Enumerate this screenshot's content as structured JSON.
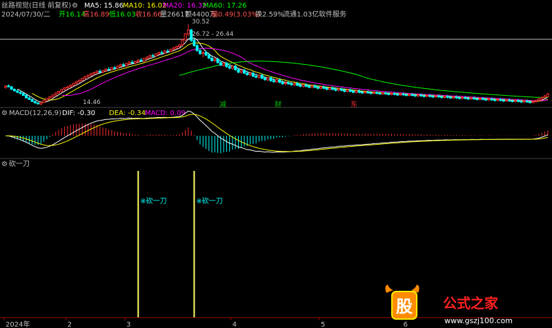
{
  "header": {
    "app_title": "丝路视觉(日线 前复权)",
    "ma_items": [
      {
        "label": "MA5: 15.86",
        "color": "#ffffff"
      },
      {
        "label": "MA10: 16.02",
        "color": "#ffff00"
      },
      {
        "label": "MA20: 16.32",
        "color": "#ff00ff"
      },
      {
        "label": "MA60: 17.26",
        "color": "#00ff00"
      }
    ],
    "ohlc_items": [
      {
        "label": "2024/07/30/二",
        "color": "#c0c0c0"
      },
      {
        "label": "开16.14",
        "color": "#00ff00"
      },
      {
        "label": "高16.89",
        "color": "#ff5050"
      },
      {
        "label": "低16.03",
        "color": "#00ff00"
      },
      {
        "label": "收16.66",
        "color": "#ff5050"
      },
      {
        "label": "量26617",
        "color": "#c0c0c0"
      },
      {
        "label": "额4400万",
        "color": "#c0c0c0"
      },
      {
        "label": "幅0.49(3.03%)",
        "color": "#ff5050"
      },
      {
        "label": "换2.59%",
        "color": "#c0c0c0"
      },
      {
        "label": "流通1.03亿",
        "color": "#c0c0c0"
      },
      {
        "label": "软件服务",
        "color": "#c0c0c0"
      }
    ]
  },
  "price_annotations": {
    "high": "30.52",
    "range": "26.72 - 26.44",
    "low": "14.46"
  },
  "event_markers": [
    {
      "label": "减",
      "color": "#00c000"
    },
    {
      "label": "财",
      "color": "#00c000"
    },
    {
      "label": "东",
      "color": "#ff3030"
    }
  ],
  "macd": {
    "title": "MACD(12,26,9)",
    "dif_label": "DIF: -0.30",
    "dea_label": "DEA: -0.34",
    "macd_label": "MACD: 0.09",
    "colors": {
      "dif": "#ffffff",
      "dea": "#ffff00",
      "macd": "#ff00ff",
      "pos_bar": "#ff3030",
      "neg_bar": "#00ffff"
    }
  },
  "indicator": {
    "title": "砍一刀",
    "signal_label": "※砍一刀",
    "signals": [
      {
        "index": 45
      },
      {
        "index": 64
      }
    ],
    "line_color": "#ffff66"
  },
  "xaxis": {
    "ticks": [
      {
        "label": "2024年",
        "index": 0
      },
      {
        "label": "2",
        "index": 21
      },
      {
        "label": "3",
        "index": 41
      },
      {
        "label": "4",
        "index": 77
      },
      {
        "label": "5",
        "index": 107
      },
      {
        "label": "6",
        "index": 135
      }
    ]
  },
  "watermark": {
    "glyph": "股",
    "text": "公式之家",
    "url": "www.gszj100.com"
  },
  "chart_data": {
    "type": "candlestick",
    "index_range": [
      0,
      200
    ],
    "candles": [
      [
        18.0,
        18.4,
        17.7,
        18.3
      ],
      [
        18.3,
        18.6,
        18.0,
        18.1
      ],
      [
        18.1,
        18.3,
        17.5,
        17.6
      ],
      [
        17.6,
        17.8,
        17.2,
        17.3
      ],
      [
        17.3,
        17.6,
        16.9,
        17.0
      ],
      [
        17.0,
        17.4,
        16.6,
        16.8
      ],
      [
        16.8,
        17.0,
        16.3,
        16.4
      ],
      [
        16.4,
        16.6,
        15.8,
        15.9
      ],
      [
        15.9,
        16.2,
        15.5,
        15.6
      ],
      [
        15.6,
        15.8,
        15.1,
        15.2
      ],
      [
        15.2,
        15.4,
        14.8,
        14.9
      ],
      [
        14.9,
        15.1,
        14.6,
        14.7
      ],
      [
        14.7,
        15.2,
        14.46,
        15.0
      ],
      [
        15.0,
        15.5,
        14.9,
        15.4
      ],
      [
        15.4,
        15.9,
        15.3,
        15.8
      ],
      [
        15.8,
        16.3,
        15.7,
        16.1
      ],
      [
        16.1,
        16.6,
        16.0,
        16.5
      ],
      [
        16.5,
        17.0,
        16.3,
        16.9
      ],
      [
        16.9,
        17.3,
        16.7,
        17.2
      ],
      [
        17.2,
        17.7,
        17.0,
        17.6
      ],
      [
        17.6,
        18.0,
        17.3,
        17.9
      ],
      [
        17.9,
        18.3,
        17.6,
        18.1
      ],
      [
        18.1,
        18.6,
        17.9,
        18.4
      ],
      [
        18.4,
        18.9,
        18.2,
        18.8
      ],
      [
        18.8,
        19.3,
        18.6,
        19.1
      ],
      [
        19.1,
        19.6,
        18.9,
        19.4
      ],
      [
        19.4,
        19.9,
        19.2,
        19.8
      ],
      [
        19.8,
        20.3,
        19.5,
        20.1
      ],
      [
        20.1,
        20.6,
        19.9,
        20.4
      ],
      [
        20.4,
        20.9,
        20.2,
        20.7
      ],
      [
        20.7,
        21.1,
        20.4,
        20.9
      ],
      [
        20.9,
        21.4,
        20.7,
        21.2
      ],
      [
        21.2,
        21.6,
        20.9,
        21.0
      ],
      [
        21.0,
        21.5,
        20.8,
        21.3
      ],
      [
        21.3,
        21.8,
        21.1,
        21.6
      ],
      [
        21.6,
        22.0,
        21.3,
        21.5
      ],
      [
        21.5,
        22.1,
        21.4,
        21.9
      ],
      [
        21.9,
        22.3,
        21.6,
        21.8
      ],
      [
        21.8,
        22.4,
        21.7,
        22.2
      ],
      [
        22.2,
        22.7,
        22.0,
        22.5
      ],
      [
        22.5,
        22.9,
        22.2,
        22.3
      ],
      [
        22.3,
        22.9,
        22.1,
        22.7
      ],
      [
        22.7,
        23.2,
        22.5,
        23.0
      ],
      [
        23.0,
        23.4,
        22.7,
        22.8
      ],
      [
        22.8,
        23.3,
        22.6,
        23.1
      ],
      [
        23.1,
        23.6,
        22.9,
        23.4
      ],
      [
        23.4,
        23.8,
        23.1,
        23.2
      ],
      [
        23.2,
        23.9,
        23.0,
        23.7
      ],
      [
        23.7,
        24.2,
        23.5,
        24.0
      ],
      [
        24.0,
        24.5,
        23.8,
        24.3
      ],
      [
        24.3,
        24.7,
        24.0,
        24.2
      ],
      [
        24.2,
        24.8,
        24.1,
        24.6
      ],
      [
        24.6,
        25.1,
        24.4,
        24.9
      ],
      [
        24.9,
        25.3,
        24.6,
        24.8
      ],
      [
        24.8,
        25.4,
        24.7,
        25.2
      ],
      [
        25.2,
        25.6,
        24.9,
        25.1
      ],
      [
        25.1,
        25.7,
        25.0,
        25.5
      ],
      [
        25.5,
        26.0,
        25.3,
        25.8
      ],
      [
        25.8,
        26.3,
        25.6,
        26.1
      ],
      [
        26.1,
        26.6,
        25.9,
        26.4
      ],
      [
        26.4,
        27.6,
        26.2,
        27.4
      ],
      [
        27.4,
        28.8,
        27.2,
        28.6
      ],
      [
        28.6,
        30.52,
        28.2,
        29.4
      ],
      [
        29.4,
        29.6,
        27.0,
        27.3
      ],
      [
        27.3,
        27.8,
        26.0,
        26.3
      ],
      [
        26.3,
        26.6,
        25.0,
        25.3
      ],
      [
        25.3,
        25.7,
        24.4,
        24.7
      ],
      [
        24.7,
        25.2,
        24.0,
        24.9
      ],
      [
        24.9,
        25.3,
        24.2,
        24.4
      ],
      [
        24.4,
        24.9,
        23.6,
        23.8
      ],
      [
        23.8,
        24.2,
        23.1,
        23.3
      ],
      [
        23.3,
        23.9,
        23.0,
        23.6
      ],
      [
        23.6,
        23.9,
        22.7,
        22.9
      ],
      [
        22.9,
        23.3,
        22.2,
        22.4
      ],
      [
        22.4,
        23.0,
        22.1,
        22.8
      ],
      [
        22.8,
        23.1,
        21.9,
        22.1
      ],
      [
        22.1,
        22.6,
        21.6,
        21.8
      ],
      [
        21.8,
        22.4,
        21.5,
        22.2
      ],
      [
        22.2,
        22.5,
        21.3,
        21.5
      ],
      [
        21.5,
        21.9,
        20.8,
        21.0
      ],
      [
        21.0,
        21.6,
        20.7,
        21.4
      ],
      [
        21.4,
        21.7,
        20.6,
        20.8
      ],
      [
        20.8,
        21.3,
        20.3,
        20.5
      ],
      [
        20.5,
        21.0,
        20.2,
        20.8
      ],
      [
        20.8,
        21.1,
        20.0,
        20.2
      ],
      [
        20.2,
        20.7,
        19.8,
        20.0
      ],
      [
        20.0,
        20.6,
        19.7,
        20.4
      ],
      [
        20.4,
        20.7,
        19.6,
        19.8
      ],
      [
        19.8,
        20.2,
        19.3,
        19.5
      ],
      [
        19.5,
        20.1,
        19.2,
        19.9
      ],
      [
        19.9,
        20.2,
        19.1,
        19.3
      ],
      [
        19.3,
        19.8,
        18.9,
        19.1
      ],
      [
        19.1,
        19.7,
        18.9,
        19.5
      ],
      [
        19.5,
        19.8,
        18.8,
        19.0
      ],
      [
        19.0,
        19.4,
        18.5,
        18.7
      ],
      [
        18.7,
        19.2,
        18.4,
        18.9
      ],
      [
        18.9,
        19.3,
        18.5,
        18.7
      ],
      [
        18.7,
        19.1,
        18.3,
        18.5
      ],
      [
        18.5,
        19.0,
        18.3,
        18.8
      ],
      [
        18.8,
        19.1,
        18.2,
        18.4
      ],
      [
        18.4,
        18.8,
        18.0,
        18.2
      ],
      [
        18.2,
        18.7,
        18.0,
        18.5
      ],
      [
        18.5,
        18.8,
        18.0,
        18.2
      ],
      [
        18.2,
        18.6,
        17.8,
        18.0
      ],
      [
        18.0,
        18.5,
        17.8,
        18.3
      ],
      [
        18.3,
        18.6,
        17.8,
        18.0
      ],
      [
        18.0,
        18.4,
        17.6,
        17.8
      ],
      [
        17.8,
        18.3,
        17.6,
        18.1
      ],
      [
        18.1,
        18.4,
        17.6,
        17.8
      ],
      [
        17.8,
        18.2,
        17.4,
        17.6
      ],
      [
        17.6,
        18.1,
        17.4,
        17.9
      ],
      [
        17.9,
        18.2,
        17.4,
        17.6
      ],
      [
        17.6,
        18.0,
        17.2,
        17.4
      ],
      [
        17.4,
        17.9,
        17.2,
        17.7
      ],
      [
        17.7,
        18.0,
        17.2,
        17.4
      ],
      [
        17.4,
        17.8,
        17.0,
        17.2
      ],
      [
        17.2,
        17.7,
        17.0,
        17.5
      ],
      [
        17.5,
        17.8,
        17.0,
        17.2
      ],
      [
        17.2,
        17.6,
        16.8,
        17.0
      ],
      [
        17.0,
        17.5,
        16.8,
        17.3
      ],
      [
        17.3,
        17.6,
        16.8,
        17.0
      ],
      [
        17.0,
        17.4,
        16.7,
        16.9
      ],
      [
        16.9,
        17.3,
        16.7,
        17.1
      ],
      [
        17.1,
        17.4,
        16.7,
        16.9
      ],
      [
        16.9,
        17.3,
        16.6,
        16.8
      ],
      [
        16.8,
        17.2,
        16.6,
        17.0
      ],
      [
        17.0,
        17.3,
        16.6,
        16.8
      ],
      [
        16.8,
        17.2,
        16.5,
        16.7
      ],
      [
        16.7,
        17.1,
        16.5,
        16.9
      ],
      [
        16.9,
        17.2,
        16.5,
        16.7
      ],
      [
        16.7,
        17.1,
        16.4,
        16.6
      ],
      [
        16.6,
        17.0,
        16.4,
        16.8
      ],
      [
        16.8,
        17.1,
        16.4,
        16.6
      ],
      [
        16.6,
        17.0,
        16.3,
        16.5
      ],
      [
        16.5,
        16.9,
        16.3,
        16.7
      ],
      [
        16.7,
        17.0,
        16.3,
        16.5
      ],
      [
        16.5,
        16.9,
        16.2,
        16.4
      ],
      [
        16.4,
        16.8,
        16.2,
        16.6
      ],
      [
        16.6,
        16.9,
        16.2,
        16.4
      ],
      [
        16.4,
        16.8,
        16.1,
        16.3
      ],
      [
        16.3,
        16.7,
        16.1,
        16.5
      ],
      [
        16.5,
        16.8,
        16.1,
        16.3
      ],
      [
        16.3,
        16.7,
        16.0,
        16.2
      ],
      [
        16.2,
        16.6,
        16.0,
        16.4
      ],
      [
        16.4,
        16.7,
        16.0,
        16.2
      ],
      [
        16.2,
        16.6,
        15.9,
        16.1
      ],
      [
        16.1,
        16.5,
        15.9,
        16.3
      ],
      [
        16.3,
        16.6,
        15.9,
        16.1
      ],
      [
        16.1,
        16.5,
        15.8,
        16.0
      ],
      [
        16.0,
        16.4,
        15.8,
        16.2
      ],
      [
        16.2,
        16.5,
        15.8,
        16.0
      ],
      [
        16.0,
        16.4,
        15.7,
        15.9
      ],
      [
        15.9,
        16.3,
        15.7,
        16.1
      ],
      [
        16.1,
        16.4,
        15.7,
        15.9
      ],
      [
        15.9,
        16.3,
        15.6,
        15.8
      ],
      [
        15.8,
        16.2,
        15.6,
        16.0
      ],
      [
        16.0,
        16.3,
        15.6,
        15.8
      ],
      [
        15.8,
        16.2,
        15.5,
        15.7
      ],
      [
        15.7,
        16.1,
        15.5,
        15.9
      ],
      [
        15.9,
        16.2,
        15.5,
        15.7
      ],
      [
        15.7,
        16.1,
        15.4,
        15.6
      ],
      [
        15.6,
        16.0,
        15.4,
        15.8
      ],
      [
        15.8,
        16.1,
        15.4,
        15.6
      ],
      [
        15.6,
        16.0,
        15.3,
        15.5
      ],
      [
        15.5,
        15.9,
        15.3,
        15.7
      ],
      [
        15.7,
        16.0,
        15.3,
        15.5
      ],
      [
        15.5,
        15.9,
        15.2,
        15.4
      ],
      [
        15.4,
        15.8,
        15.2,
        15.6
      ],
      [
        15.6,
        15.9,
        15.2,
        15.4
      ],
      [
        15.4,
        15.8,
        15.1,
        15.3
      ],
      [
        15.3,
        15.7,
        15.1,
        15.5
      ],
      [
        15.5,
        15.8,
        15.1,
        15.3
      ],
      [
        15.3,
        15.7,
        15.0,
        15.2
      ],
      [
        15.2,
        15.6,
        15.0,
        15.4
      ],
      [
        15.4,
        15.7,
        15.0,
        15.2
      ],
      [
        15.2,
        15.6,
        14.9,
        15.1
      ],
      [
        15.1,
        15.5,
        14.9,
        15.3
      ],
      [
        15.3,
        15.6,
        14.9,
        15.1
      ],
      [
        15.1,
        15.5,
        14.8,
        15.0
      ],
      [
        15.0,
        15.4,
        14.8,
        15.2
      ],
      [
        15.2,
        15.6,
        14.9,
        15.4
      ],
      [
        15.4,
        15.9,
        15.2,
        15.7
      ],
      [
        15.7,
        16.2,
        15.5,
        16.0
      ],
      [
        16.0,
        16.5,
        15.8,
        16.3
      ],
      [
        16.14,
        16.89,
        16.03,
        16.66
      ]
    ],
    "ylim": [
      14.0,
      31.5
    ]
  }
}
